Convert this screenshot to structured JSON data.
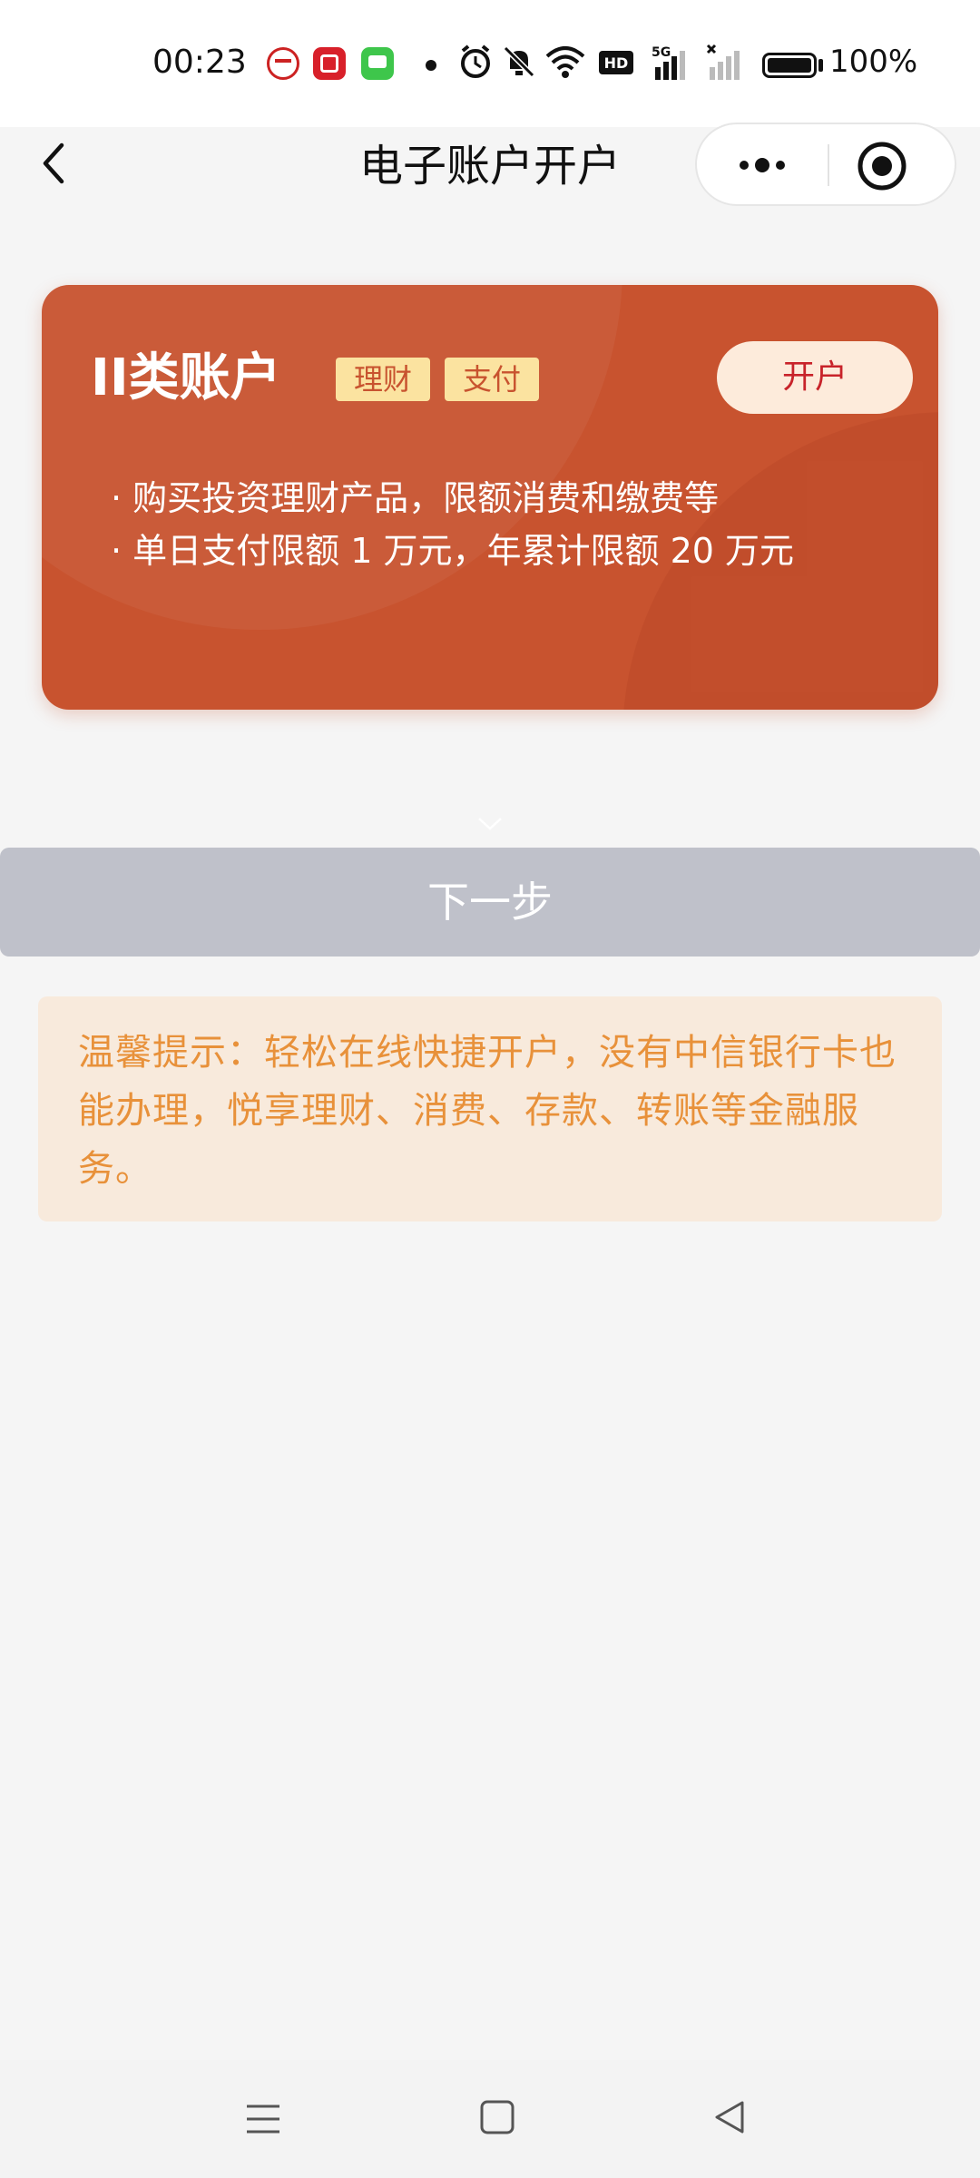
{
  "status_bar": {
    "time": "00:23",
    "battery": "100%",
    "icons": [
      "cmb-app-icon",
      "citic-app-icon",
      "messages-app-icon",
      "alarm-icon",
      "mute-icon",
      "wifi-icon",
      "hd-icon",
      "signal-5g-icon",
      "signal-no-service-icon",
      "battery-icon"
    ]
  },
  "nav": {
    "title": "电子账户开户",
    "back_icon": "chevron-left-icon",
    "more_icon": "more-dots-icon",
    "close_icon": "target-close-icon"
  },
  "card": {
    "title": "II类账户",
    "tags": [
      "理财",
      "支付"
    ],
    "open_button": "开户",
    "features": [
      "· 购买投资理财产品，限额消费和缴费等",
      "· 单日支付限额 1 万元，年累计限额 20 万元"
    ],
    "color": "#c8532f"
  },
  "next_button": {
    "label": "下一步",
    "color": "#bfc1ca"
  },
  "tip": {
    "text": "温馨提示：轻松在线快捷开户，没有中信银行卡也能办理，悦享理财、消费、存款、转账等金融服务。",
    "color": "#e8913a"
  },
  "bottom_nav": {
    "icons": [
      "menu-icon",
      "home-square-icon",
      "back-triangle-icon"
    ]
  }
}
